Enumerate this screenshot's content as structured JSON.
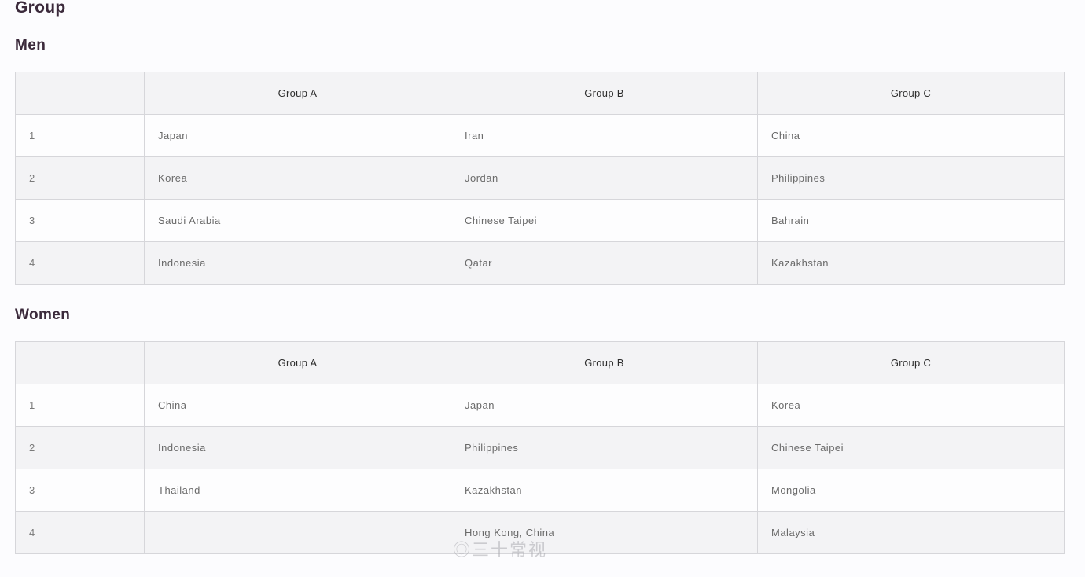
{
  "page": {
    "title": "Group"
  },
  "men": {
    "title": "Men",
    "headers": [
      "",
      "Group A",
      "Group B",
      "Group C"
    ],
    "rows": [
      [
        "1",
        "Japan",
        "Iran",
        "China"
      ],
      [
        "2",
        "Korea",
        "Jordan",
        "Philippines"
      ],
      [
        "3",
        "Saudi Arabia",
        "Chinese Taipei",
        "Bahrain"
      ],
      [
        "4",
        "Indonesia",
        "Qatar",
        "Kazakhstan"
      ]
    ]
  },
  "women": {
    "title": "Women",
    "headers": [
      "",
      "Group A",
      "Group B",
      "Group C"
    ],
    "rows": [
      [
        "1",
        "China",
        "Japan",
        "Korea"
      ],
      [
        "2",
        "Indonesia",
        "Philippines",
        "Chinese Taipei"
      ],
      [
        "3",
        "Thailand",
        "Kazakhstan",
        "Mongolia"
      ],
      [
        "4",
        "",
        "Hong Kong, China",
        "Malaysia"
      ]
    ]
  },
  "watermark": {
    "text": "◎三十常视"
  }
}
